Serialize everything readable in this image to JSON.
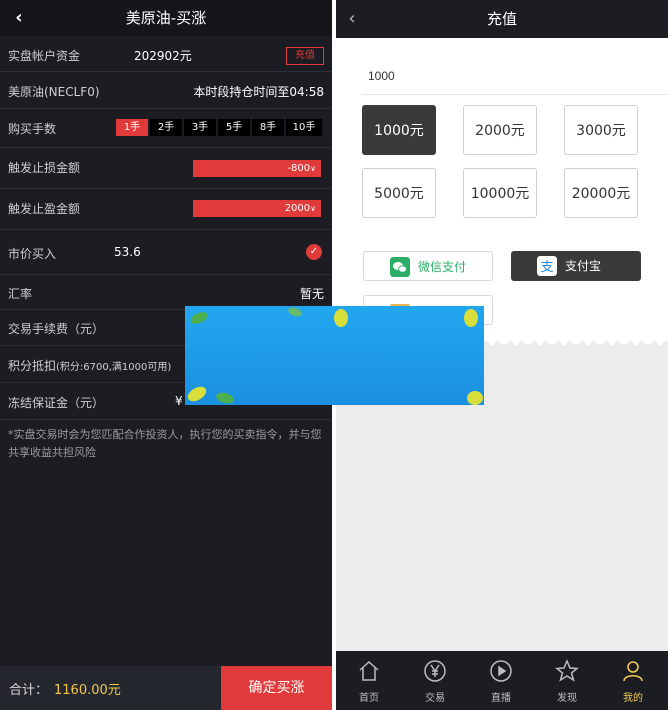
{
  "left": {
    "title": "美原油-买涨",
    "account_label": "实盘帐户资金",
    "account_value": "202902元",
    "recharge": "充值",
    "product": "美原油(NECLF0)",
    "hold_time": "本时段持仓时间至04:58",
    "lots_label": "购买手数",
    "lots": [
      "1手",
      "2手",
      "3手",
      "5手",
      "8手",
      "10手"
    ],
    "lots_selected": "1手",
    "stop_loss_label": "触发止损金额",
    "stop_loss_value": "-800",
    "take_profit_label": "触发止盈金额",
    "take_profit_value": "2000",
    "market_label": "市价买入",
    "market_value": "53.6",
    "rate_label": "汇率",
    "rate_value": "暂无",
    "fee_label": "交易手续费（元）",
    "points_label": "积分抵扣",
    "points_detail": "(积分:6700,满1000可用)",
    "margin_label": "冻结保证金（元）",
    "margin_value_prefix": "¥",
    "note": "*实盘交易时会为您匹配合作投资人，执行您的买卖指令，并与您共享收益共担风险",
    "total_label": "合计：",
    "total_value": "1160.00元",
    "confirm": "确定买涨"
  },
  "right": {
    "title": "充值",
    "amount_value": "1000",
    "amounts": [
      "1000元",
      "2000元",
      "3000元",
      "5000元",
      "10000元",
      "20000元"
    ],
    "amount_selected": "1000元",
    "pay_wechat": "微信支付",
    "pay_alipay": "支付宝",
    "tabs": [
      "首页",
      "交易",
      "直播",
      "发现",
      "我的"
    ],
    "tab_active": "我的"
  },
  "colors": {
    "accent_red": "#e03a3a",
    "gold": "#f2c94c",
    "dark_bg": "#1b1d23",
    "wechat_green": "#2aae67",
    "alipay_blue": "#1e88e5",
    "banner_blue": "#1e9be8"
  }
}
